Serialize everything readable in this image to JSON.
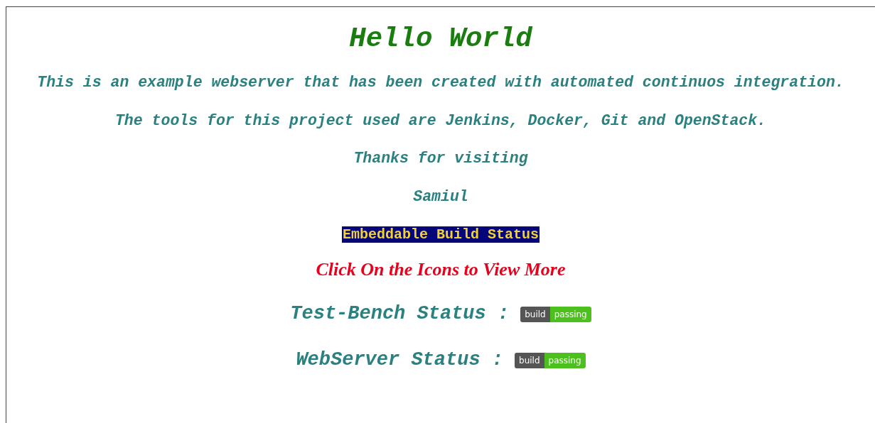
{
  "heading": "Hello World",
  "lines": [
    "This is an example webserver that has been created with automated continuos integration.",
    "The tools for this project used are Jenkins, Docker, Git and OpenStack.",
    "Thanks for visiting",
    "Samiul"
  ],
  "banner": "Embeddable Build Status",
  "hint": "Click On the Icons to View More",
  "statuses": [
    {
      "label": "Test-Bench Status :",
      "badge_label": "build",
      "badge_message": "passing"
    },
    {
      "label": "WebServer Status :",
      "badge_label": "build",
      "badge_message": "passing"
    }
  ]
}
